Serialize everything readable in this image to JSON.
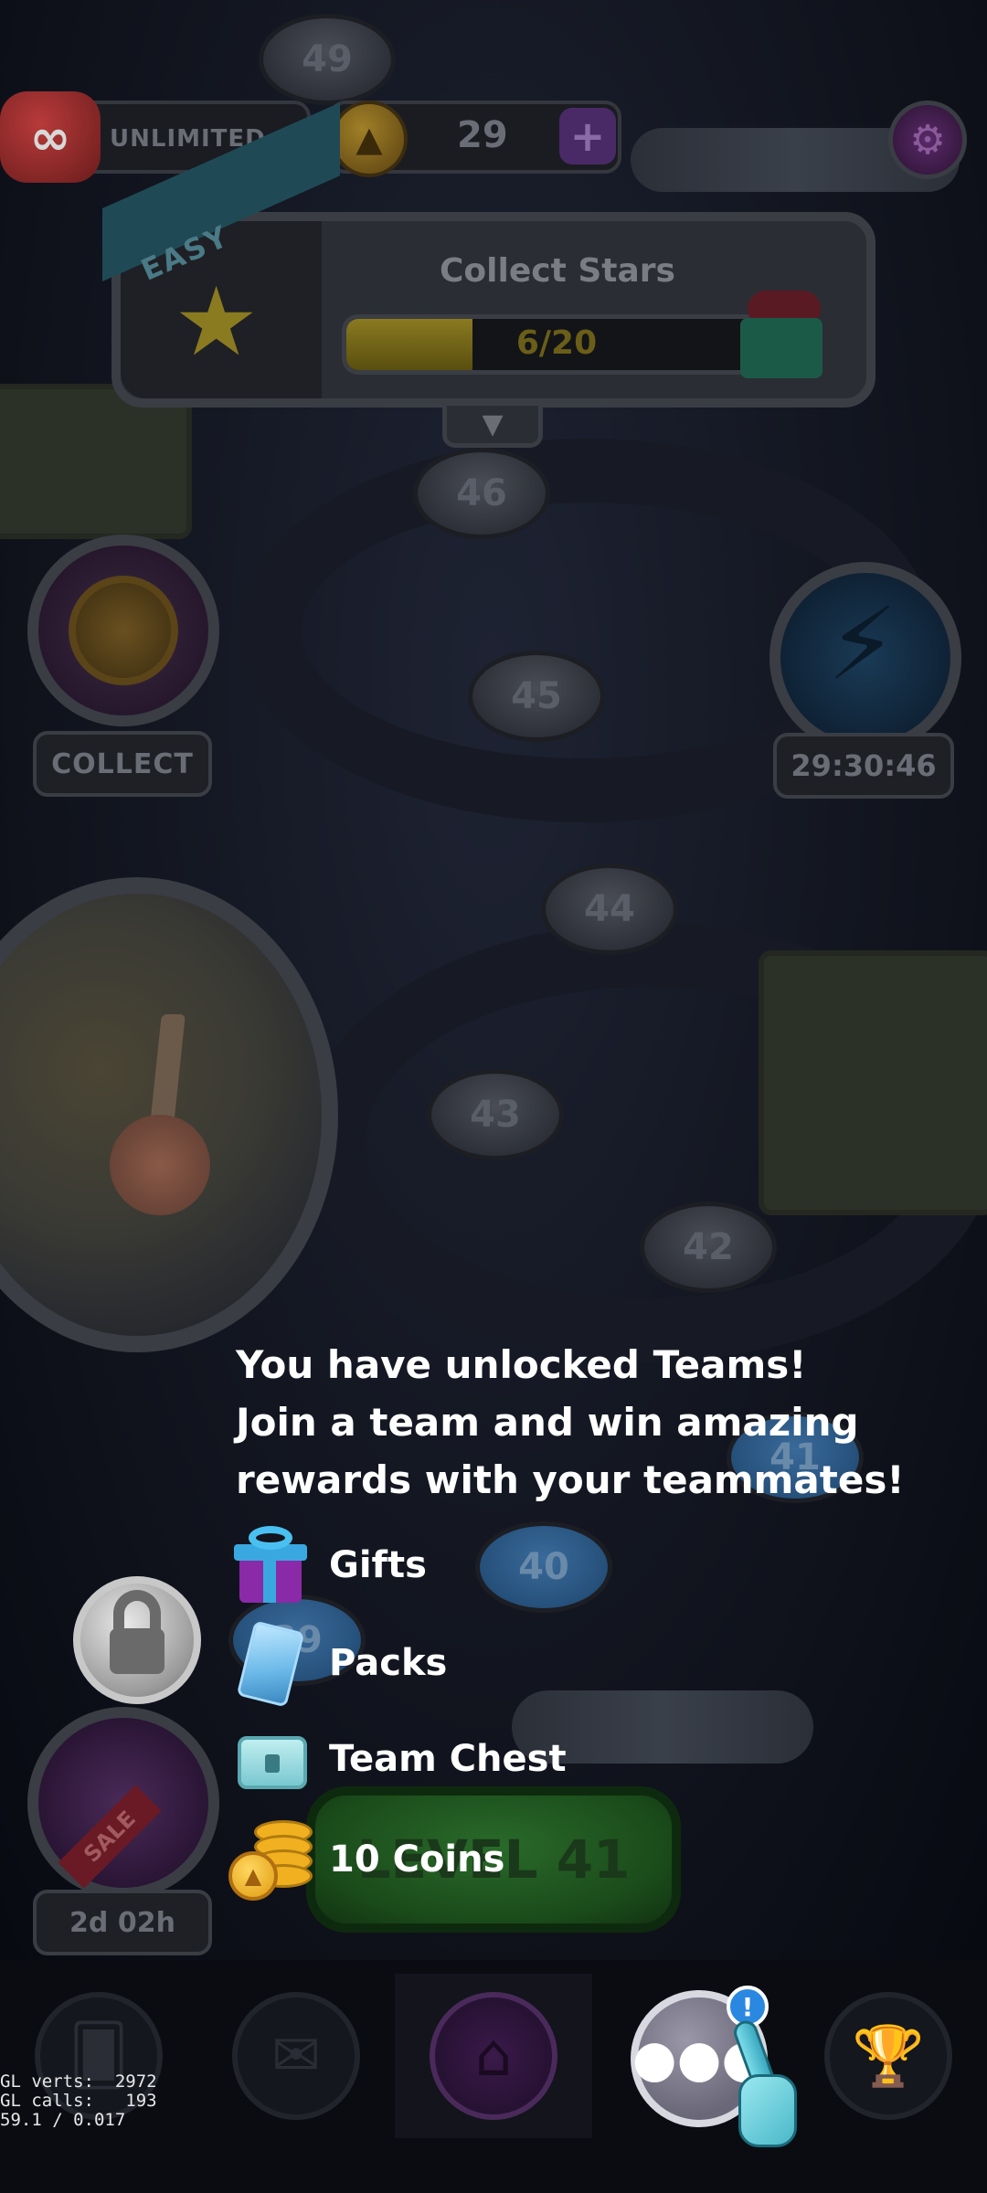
{
  "hud": {
    "lives_label": "UNLIMITED",
    "lives_symbol": "∞",
    "coins": "29",
    "coin_plus": "+"
  },
  "quest": {
    "difficulty": "EASY",
    "title": "Collect Stars",
    "progress_text": "6/20",
    "progress_fraction": 0.3
  },
  "side": {
    "collect_label": "COLLECT",
    "timer": "29:30:46",
    "sale_label": "SALE",
    "sale_timer": "2d 02h"
  },
  "levels": [
    {
      "num": "49"
    },
    {
      "num": "46"
    },
    {
      "num": "45"
    },
    {
      "num": "44"
    },
    {
      "num": "43"
    },
    {
      "num": "42"
    },
    {
      "num": "41"
    },
    {
      "num": "40"
    },
    {
      "num": "39"
    }
  ],
  "play_button": "LEVEL 41",
  "onboarding": {
    "line1": "You have unlocked Teams!",
    "line2": "Join a team and win amazing",
    "line3": "rewards with your teammates!",
    "rewards": [
      {
        "label": "Gifts",
        "icon": "gift-icon"
      },
      {
        "label": "Packs",
        "icon": "card-pack-icon"
      },
      {
        "label": "Team Chest",
        "icon": "chest-icon"
      },
      {
        "label": "10 Coins",
        "icon": "coin-stack-icon"
      }
    ]
  },
  "nav": {
    "items": [
      {
        "name": "cards",
        "icon": "cards-icon"
      },
      {
        "name": "inbox",
        "icon": "mail-icon"
      },
      {
        "name": "home",
        "icon": "home-icon"
      },
      {
        "name": "teams",
        "icon": "team-icon"
      },
      {
        "name": "leaderboard",
        "icon": "trophy-icon"
      }
    ],
    "active": "home",
    "team_alert": "!"
  },
  "debug": {
    "line1": "GL verts:  2972",
    "line2": "GL calls:   193",
    "line3": "59.1 / 0.017"
  },
  "colors": {
    "overlay_text": "#ffffff",
    "team_badge": "#2a88e0",
    "coin_gold": "#f0b020"
  }
}
